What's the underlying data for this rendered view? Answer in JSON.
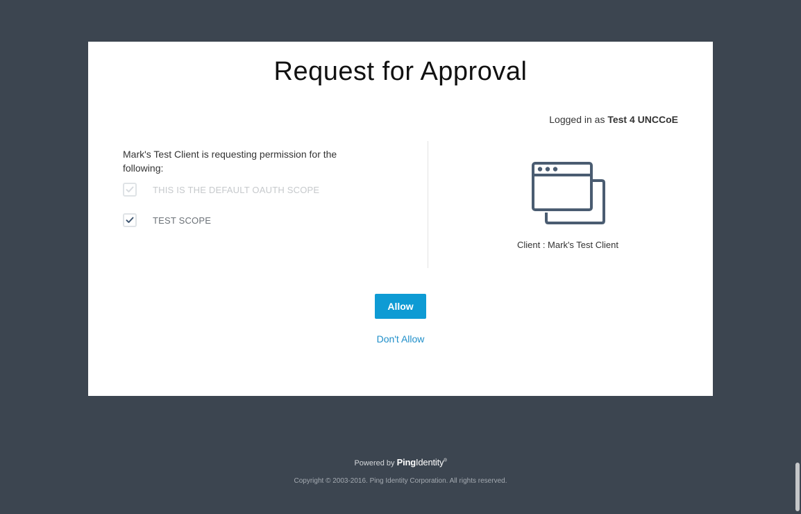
{
  "title": "Request for Approval",
  "logged_in": {
    "prefix": "Logged in as",
    "user": "Test 4 UNCCoE"
  },
  "request": {
    "text": "Mark's Test Client is requesting permission for the following:"
  },
  "scopes": [
    {
      "label": "THIS IS THE DEFAULT OAUTH SCOPE",
      "checked": true,
      "disabled": true
    },
    {
      "label": "TEST SCOPE",
      "checked": true,
      "disabled": false
    }
  ],
  "client": {
    "icon": "browser-windows-icon",
    "label": "Client : Mark's Test Client"
  },
  "actions": {
    "allow_label": "Allow",
    "deny_label": "Don't Allow"
  },
  "footer": {
    "powered_by": "Powered by",
    "brand_ping": "Ping",
    "brand_identity": "Identity",
    "trademark": "®",
    "copyright": "Copyright © 2003-2016. Ping Identity Corporation. All rights reserved."
  },
  "colors": {
    "background": "#3c4550",
    "accent": "#0e9bd4",
    "link": "#1e8ec9",
    "icon": "#4a5c71"
  }
}
